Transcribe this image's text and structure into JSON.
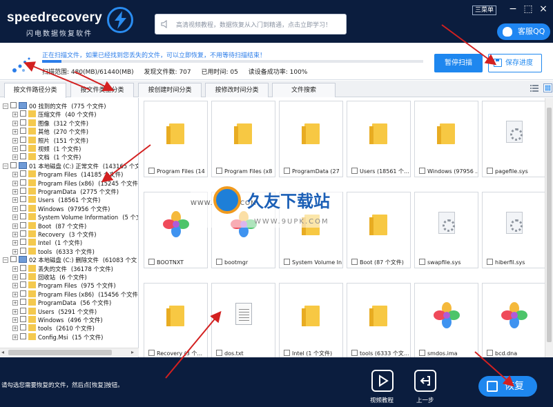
{
  "app": {
    "logo_text": "speedrecovery",
    "logo_subtitle": "闪电数据恢复软件",
    "ad_text": "高清视频教程，数据恢复从入门到精通，点击立即学习！",
    "menu_label": "三菜单",
    "qq_label": "客服QQ"
  },
  "scan": {
    "message": "正在扫描文件，如果已经找到您丢失的文件，可以立即恢复，不用等待扫描结束！",
    "progress": 0.05,
    "range": "扫描范围: 480(MB)/61440(MB)",
    "found": "发现文件数: 707",
    "elapsed": "已用时间: 05",
    "read_rate": "读设备成功率: 100%",
    "pause_label": "暂停扫描",
    "save_label": "保存进度"
  },
  "tabs": [
    {
      "label": "按文件路径分类",
      "active": true
    },
    {
      "label": "按文件类型分类",
      "active": false
    },
    {
      "label": "按创建时间分类",
      "active": false
    },
    {
      "label": "按修改时间分类",
      "active": false
    },
    {
      "label": "文件搜索",
      "active": false
    }
  ],
  "tree": [
    {
      "label": "00 找到的文件",
      "count": "(775 个文件)",
      "level": 0,
      "kind": "drive"
    },
    {
      "label": "压缩文件",
      "count": "(40 个文件)",
      "level": 1,
      "kind": "folder"
    },
    {
      "label": "图像",
      "count": "(312 个文件)",
      "level": 1,
      "kind": "folder"
    },
    {
      "label": "其他",
      "count": "(270 个文件)",
      "level": 1,
      "kind": "folder"
    },
    {
      "label": "照片",
      "count": "(151 个文件)",
      "level": 1,
      "kind": "folder"
    },
    {
      "label": "视频",
      "count": "(1 个文件)",
      "level": 1,
      "kind": "folder"
    },
    {
      "label": "文档",
      "count": "(1 个文件)",
      "level": 1,
      "kind": "folder"
    },
    {
      "label": "01 本地磁盘 (C:) 正常文件",
      "count": "(143165 个文",
      "level": 0,
      "kind": "drive"
    },
    {
      "label": "Program Files",
      "count": "(14185 个文件)",
      "level": 1,
      "kind": "folder"
    },
    {
      "label": "Program Files (x86)",
      "count": "(15245 个文件)",
      "level": 1,
      "kind": "folder"
    },
    {
      "label": "ProgramData",
      "count": "(2775 个文件)",
      "level": 1,
      "kind": "folder"
    },
    {
      "label": "Users",
      "count": "(18561 个文件)",
      "level": 1,
      "kind": "folder"
    },
    {
      "label": "Windows",
      "count": "(97956 个文件)",
      "level": 1,
      "kind": "folder"
    },
    {
      "label": "System Volume Information",
      "count": "(5 个文",
      "level": 1,
      "kind": "folder"
    },
    {
      "label": "Boot",
      "count": "(87 个文件)",
      "level": 1,
      "kind": "folder"
    },
    {
      "label": "Recovery",
      "count": "(3 个文件)",
      "level": 1,
      "kind": "folder"
    },
    {
      "label": "Intel",
      "count": "(1 个文件)",
      "level": 1,
      "kind": "folder"
    },
    {
      "label": "tools",
      "count": "(6333 个文件)",
      "level": 1,
      "kind": "folder"
    },
    {
      "label": "02 本地磁盘 (C:) 删除文件",
      "count": "(61083 个文",
      "level": 0,
      "kind": "drive"
    },
    {
      "label": "丢失的文件",
      "count": "(36178 个文件)",
      "level": 1,
      "kind": "folder"
    },
    {
      "label": "回收站",
      "count": "(6 个文件)",
      "level": 1,
      "kind": "folder"
    },
    {
      "label": "Program Files",
      "count": "(975 个文件)",
      "level": 1,
      "kind": "folder"
    },
    {
      "label": "Program Files (x86)",
      "count": "(15456 个文件)",
      "level": 1,
      "kind": "folder"
    },
    {
      "label": "ProgramData",
      "count": "(56 个文件)",
      "level": 1,
      "kind": "folder"
    },
    {
      "label": "Users",
      "count": "(5291 个文件)",
      "level": 1,
      "kind": "folder"
    },
    {
      "label": "Windows",
      "count": "(496 个文件)",
      "level": 1,
      "kind": "folder"
    },
    {
      "label": "tools",
      "count": "(2610 个文件)",
      "level": 1,
      "kind": "folder"
    },
    {
      "label": "Config.Msi",
      "count": "(15 个文件)",
      "level": 1,
      "kind": "folder"
    }
  ],
  "files": [
    {
      "name": "Program Files (14",
      "type": "folder"
    },
    {
      "name": "Program Files (x8",
      "type": "folder"
    },
    {
      "name": "ProgramData (27",
      "type": "folder"
    },
    {
      "name": "Users (18561 个...",
      "type": "folder"
    },
    {
      "name": "Windows (97956 ...",
      "type": "folder"
    },
    {
      "name": "pagefile.sys",
      "type": "system"
    },
    {
      "name": "BOOTNXT",
      "type": "colorful"
    },
    {
      "name": "bootmgr",
      "type": "colorful"
    },
    {
      "name": "System Volume In...",
      "type": "folder"
    },
    {
      "name": "Boot (87 个文件)",
      "type": "folder"
    },
    {
      "name": "swapfile.sys",
      "type": "system"
    },
    {
      "name": "hiberfil.sys",
      "type": "system"
    },
    {
      "name": "Recovery (3 个...",
      "type": "folder"
    },
    {
      "name": "dos.txt",
      "type": "text"
    },
    {
      "name": "Intel (1 个文件)",
      "type": "folder"
    },
    {
      "name": "tools (6333 个文...",
      "type": "folder"
    },
    {
      "name": "smdos.ima",
      "type": "colorful"
    },
    {
      "name": "bcd.dna",
      "type": "colorful"
    }
  ],
  "watermark": {
    "title": "久友下载站",
    "url": "WWW. 9UPK. COM",
    "url2": "WWW.9UPK.COM"
  },
  "footer": {
    "hint": "请勾选您需要恢复的文件，然后点[恢复]按钮。",
    "video_label": "视频教程",
    "back_label": "上一步",
    "recover_label": "恢复"
  },
  "colors": {
    "header_bg": "#0b1d3e",
    "accent": "#1e87ef",
    "scan_text": "#2b7de9",
    "arrow": "#d32020",
    "folder": "#f7c843"
  }
}
